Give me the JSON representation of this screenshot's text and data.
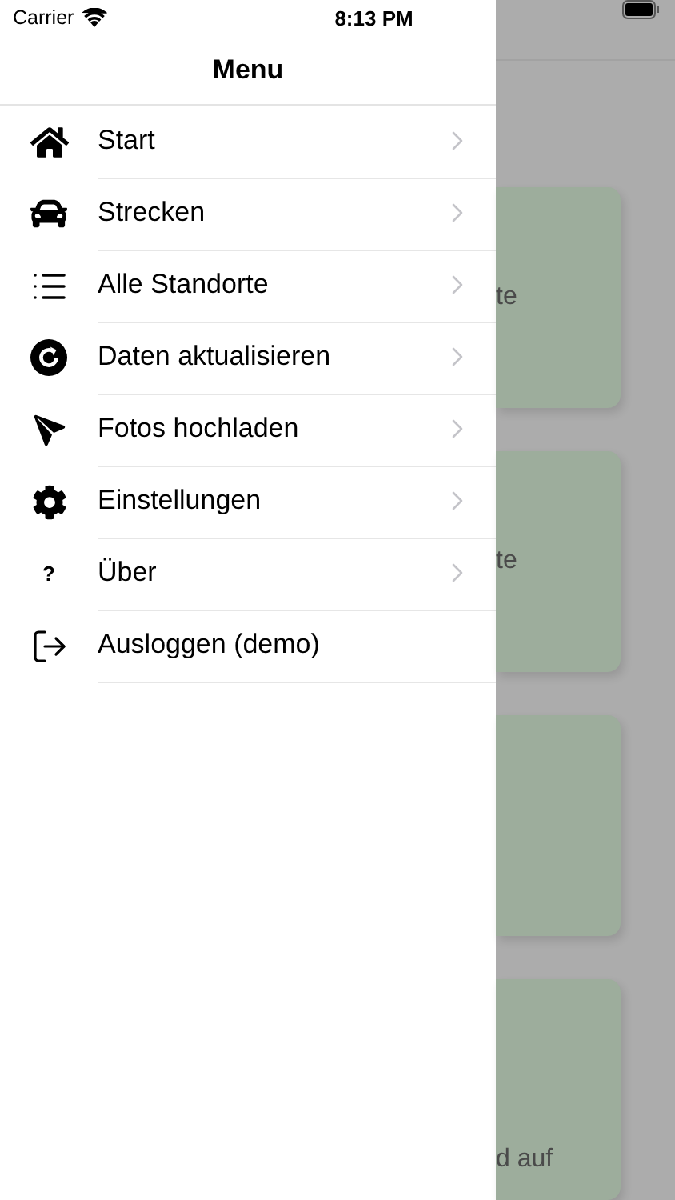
{
  "status_bar": {
    "carrier": "Carrier",
    "time": "8:13 PM"
  },
  "menu": {
    "title": "Menu",
    "items": [
      {
        "label": "Start",
        "kind": "home",
        "chevron": true
      },
      {
        "label": "Strecken",
        "kind": "car",
        "chevron": true
      },
      {
        "label": "Alle Standorte",
        "kind": "list",
        "chevron": true
      },
      {
        "label": "Daten aktualisieren",
        "kind": "refresh",
        "chevron": true
      },
      {
        "label": "Fotos hochladen",
        "kind": "plane",
        "chevron": true
      },
      {
        "label": "Einstellungen",
        "kind": "gear",
        "chevron": true
      },
      {
        "label": "Über",
        "kind": "glyph",
        "icon_text": "?",
        "chevron": true
      },
      {
        "label": "Ausloggen (demo)",
        "kind": "logout",
        "chevron": false
      }
    ]
  },
  "background_cards": [
    {
      "kind": "middle",
      "text": "te"
    },
    {
      "kind": "middle",
      "text": "te"
    },
    {
      "kind": "empty"
    },
    {
      "kind": "bottom",
      "text": "d auf"
    }
  ]
}
